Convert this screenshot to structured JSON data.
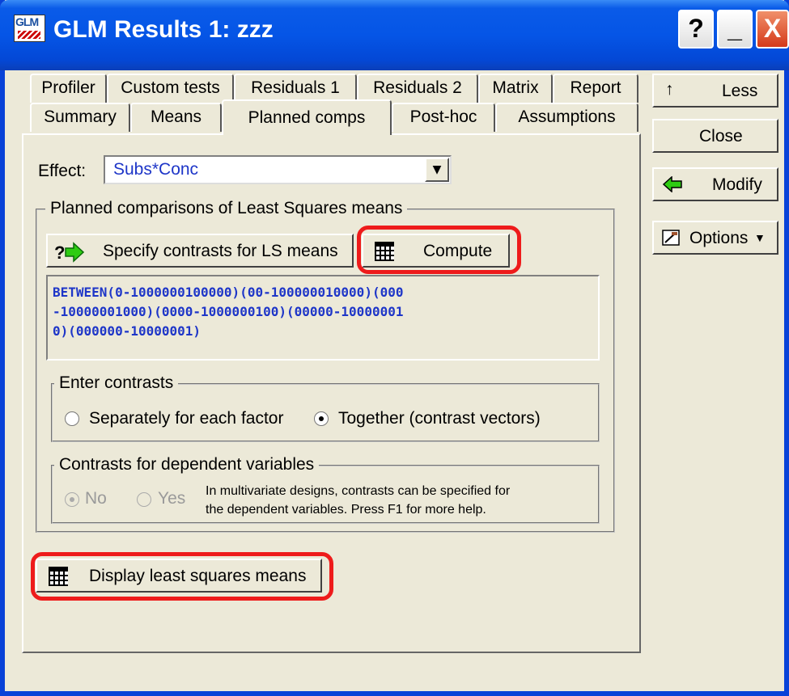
{
  "window": {
    "title": "GLM Results 1: zzz",
    "icon_text": "GLM"
  },
  "title_buttons": {
    "help": "?",
    "minimize": "_",
    "close": "X"
  },
  "tabs_row1": [
    "Profiler",
    "Custom tests",
    "Residuals 1",
    "Residuals 2",
    "Matrix",
    "Report"
  ],
  "tabs_row2": [
    "Summary",
    "Means",
    "Planned comps",
    "Post-hoc",
    "Assumptions"
  ],
  "active_tab": "Planned comps",
  "effect": {
    "label": "Effect:",
    "value": "Subs*Conc"
  },
  "planned_group": {
    "legend": "Planned comparisons of Least Squares means",
    "specify_button": "Specify contrasts for LS means",
    "compute_button": "Compute",
    "contrasts_lines": [
      "BETWEEN(0-1000000100000)(00-100000010000)(000",
      "-10000001000)(0000-1000000100)(00000-10000001",
      "0)(000000-10000001)"
    ]
  },
  "enter_contrasts": {
    "legend": "Enter contrasts",
    "options": [
      "Separately for each factor",
      "Together (contrast vectors)"
    ],
    "selected": "Together (contrast vectors)"
  },
  "dependent_contrasts": {
    "legend": "Contrasts for dependent variables",
    "options": [
      "No",
      "Yes"
    ],
    "selected": "No",
    "disabled": true,
    "help_lines": [
      "In multivariate designs, contrasts can be specified for",
      "the dependent variables.  Press F1 for more help."
    ]
  },
  "display_button": "Display least squares means",
  "side_buttons": {
    "less": "Less",
    "less_icon": "↑",
    "close": "Close",
    "modify": "Modify",
    "options": "Options",
    "options_arrow": "▼"
  },
  "colors": {
    "titlebar": "#0555e6",
    "highlight": "#ee1b1b",
    "link_text": "#1e36c8",
    "face": "#ece9d8"
  }
}
